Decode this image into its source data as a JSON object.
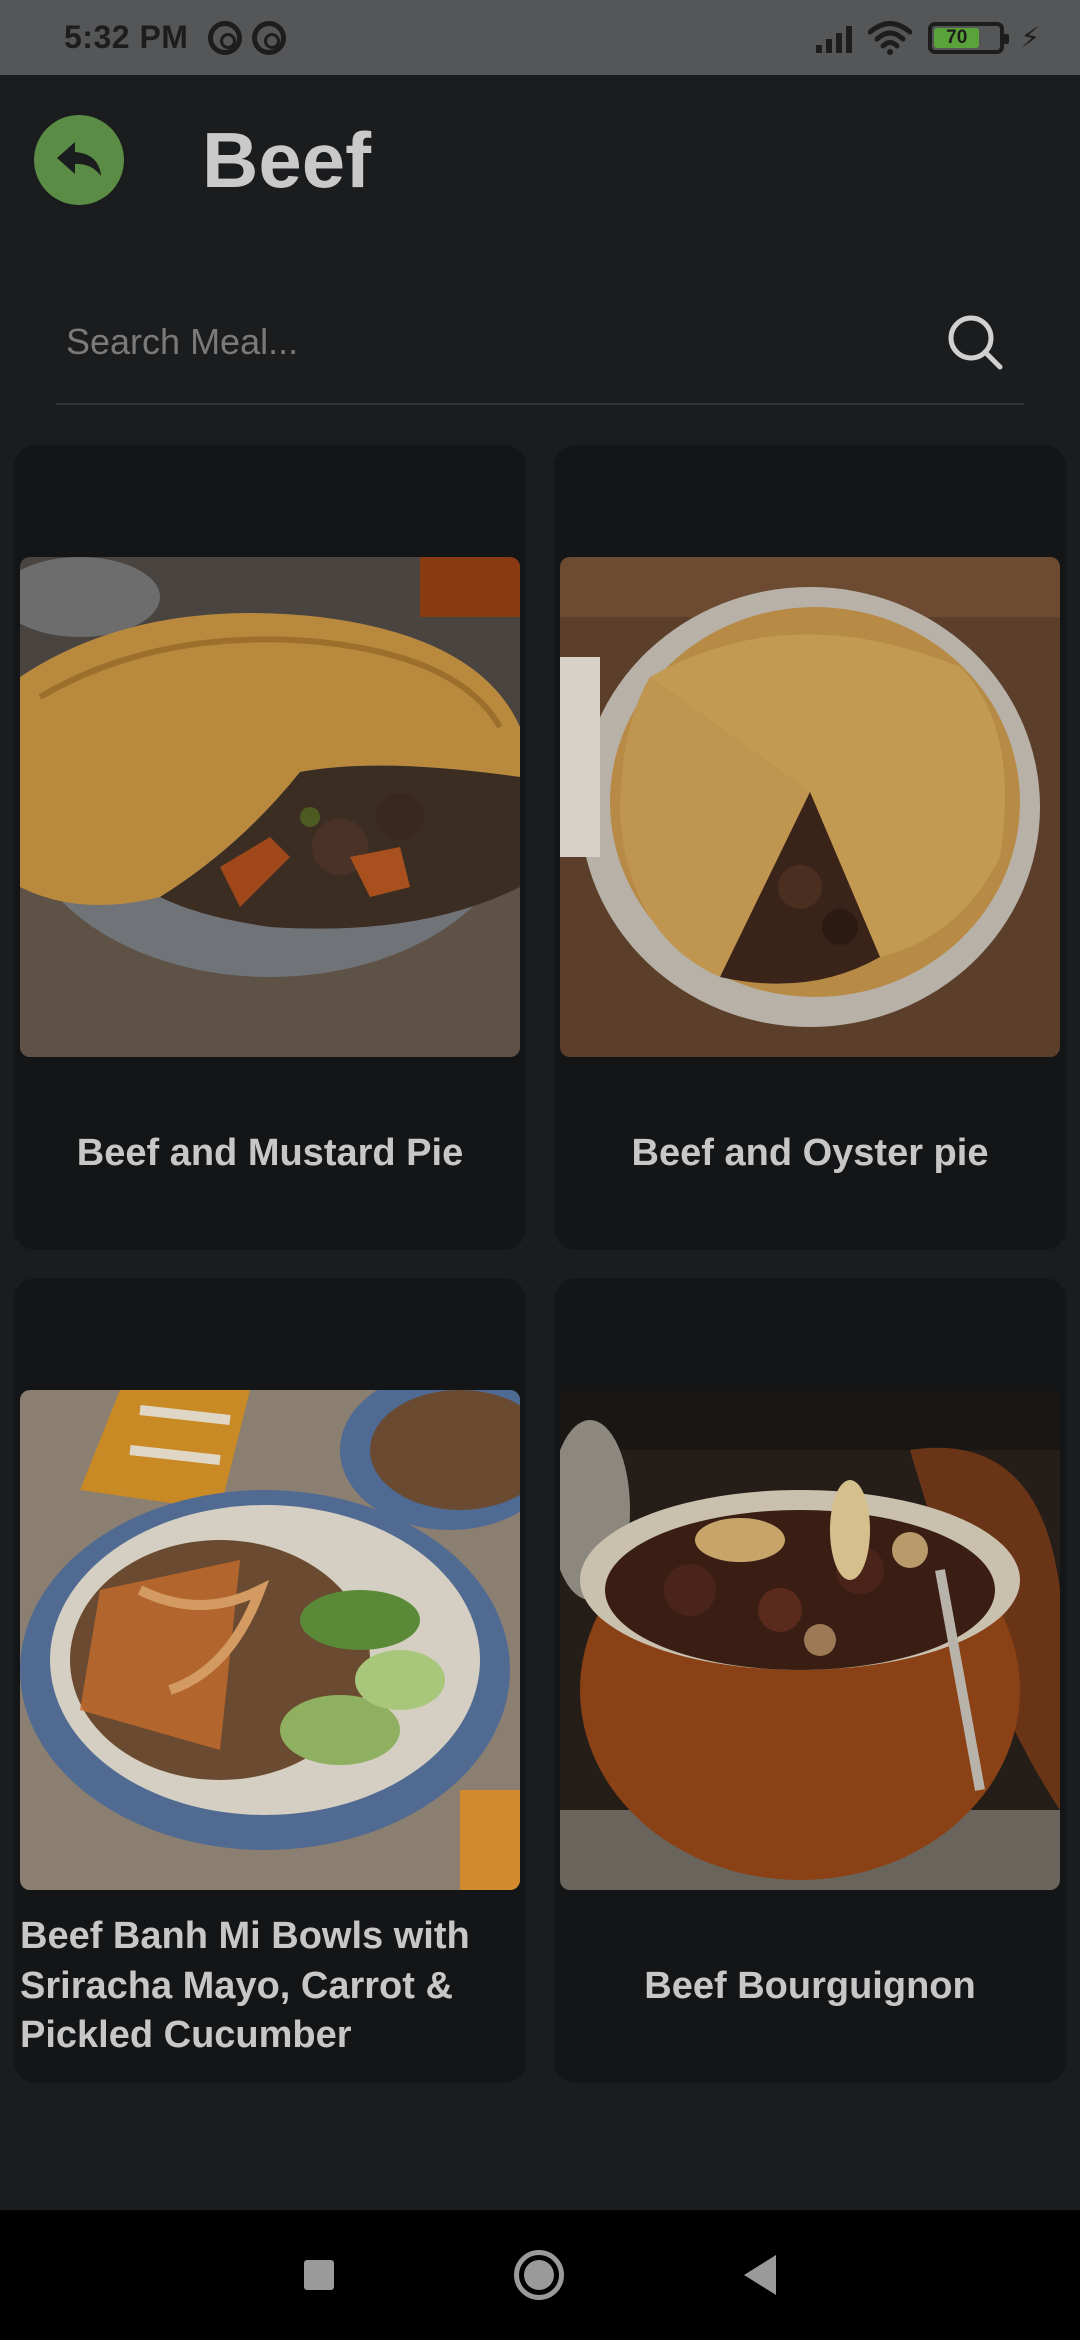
{
  "status_bar": {
    "time": "5:32 PM",
    "battery_level": "70",
    "icons": [
      "a-circle-icon",
      "a-circle-icon",
      "signal-icon",
      "wifi-icon",
      "battery-icon",
      "charging-bolt-icon"
    ]
  },
  "header": {
    "title": "Beef",
    "back_icon": "back-arrow-icon",
    "accent_color": "#5b8c45"
  },
  "search": {
    "placeholder": "Search Meal...",
    "value": "",
    "icon": "search-icon"
  },
  "meals": [
    {
      "name": "Beef and Mustard Pie",
      "image": "pie-with-carrots"
    },
    {
      "name": "Beef and Oyster pie",
      "image": "pie-with-slice-cut"
    },
    {
      "name": "Beef Banh Mi Bowls with Sriracha Mayo, Carrot & Pickled Cucumber",
      "name_lines": [
        "Beef Banh Mi Bowls with",
        "Sriracha Mayo, Carrot &",
        "Pickled Cucumber"
      ],
      "image": "rice-bowl-with-beef"
    },
    {
      "name": "Beef Bourguignon",
      "image": "stew-in-casserole"
    }
  ],
  "nav_bar": {
    "icons": [
      "recent-apps-icon",
      "home-icon",
      "back-icon"
    ]
  }
}
